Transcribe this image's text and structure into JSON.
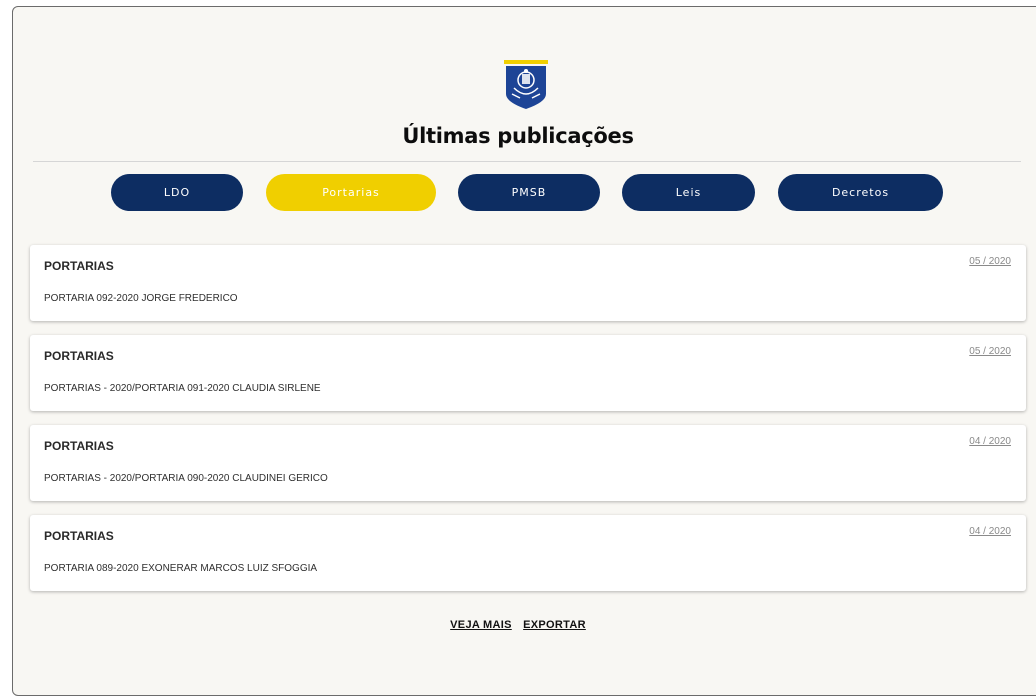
{
  "header": {
    "title": "Últimas publicações"
  },
  "tabs": [
    {
      "label": "LDO",
      "active": false
    },
    {
      "label": "Portarias",
      "active": true
    },
    {
      "label": "PMSB",
      "active": false
    },
    {
      "label": "Leis",
      "active": false
    },
    {
      "label": "Decretos",
      "active": false
    }
  ],
  "publications": [
    {
      "category": "PORTARIAS",
      "date": "05 / 2020",
      "description": "PORTARIA 092-2020 JORGE FREDERICO"
    },
    {
      "category": "PORTARIAS",
      "date": "05 / 2020",
      "description": "PORTARIAS - 2020/PORTARIA 091-2020 CLAUDIA SIRLENE"
    },
    {
      "category": "PORTARIAS",
      "date": "04 / 2020",
      "description": "PORTARIAS - 2020/PORTARIA 090-2020 CLAUDINEI GERICO"
    },
    {
      "category": "PORTARIAS",
      "date": "04 / 2020",
      "description": "PORTARIA 089-2020 EXONERAR MARCOS LUIZ SFOGGIA"
    }
  ],
  "footer": {
    "see_more": "VEJA MAIS",
    "export": "EXPORTAR"
  },
  "colors": {
    "navy": "#0d2d62",
    "yellow": "#f0cf00",
    "background": "#f8f7f3"
  },
  "icons": {
    "logo": "coat-of-arms-icon"
  }
}
